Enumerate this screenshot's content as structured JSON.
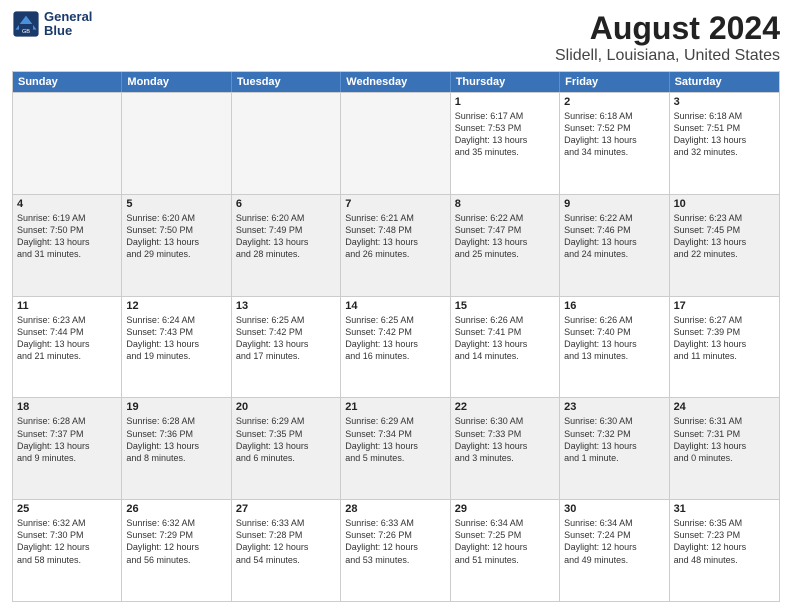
{
  "header": {
    "logo_line1": "General",
    "logo_line2": "Blue",
    "title": "August 2024",
    "subtitle": "Slidell, Louisiana, United States"
  },
  "weekdays": [
    "Sunday",
    "Monday",
    "Tuesday",
    "Wednesday",
    "Thursday",
    "Friday",
    "Saturday"
  ],
  "weeks": [
    [
      {
        "day": "",
        "info": "",
        "empty": true
      },
      {
        "day": "",
        "info": "",
        "empty": true
      },
      {
        "day": "",
        "info": "",
        "empty": true
      },
      {
        "day": "",
        "info": "",
        "empty": true
      },
      {
        "day": "1",
        "info": "Sunrise: 6:17 AM\nSunset: 7:53 PM\nDaylight: 13 hours\nand 35 minutes."
      },
      {
        "day": "2",
        "info": "Sunrise: 6:18 AM\nSunset: 7:52 PM\nDaylight: 13 hours\nand 34 minutes."
      },
      {
        "day": "3",
        "info": "Sunrise: 6:18 AM\nSunset: 7:51 PM\nDaylight: 13 hours\nand 32 minutes."
      }
    ],
    [
      {
        "day": "4",
        "info": "Sunrise: 6:19 AM\nSunset: 7:50 PM\nDaylight: 13 hours\nand 31 minutes."
      },
      {
        "day": "5",
        "info": "Sunrise: 6:20 AM\nSunset: 7:50 PM\nDaylight: 13 hours\nand 29 minutes."
      },
      {
        "day": "6",
        "info": "Sunrise: 6:20 AM\nSunset: 7:49 PM\nDaylight: 13 hours\nand 28 minutes."
      },
      {
        "day": "7",
        "info": "Sunrise: 6:21 AM\nSunset: 7:48 PM\nDaylight: 13 hours\nand 26 minutes."
      },
      {
        "day": "8",
        "info": "Sunrise: 6:22 AM\nSunset: 7:47 PM\nDaylight: 13 hours\nand 25 minutes."
      },
      {
        "day": "9",
        "info": "Sunrise: 6:22 AM\nSunset: 7:46 PM\nDaylight: 13 hours\nand 24 minutes."
      },
      {
        "day": "10",
        "info": "Sunrise: 6:23 AM\nSunset: 7:45 PM\nDaylight: 13 hours\nand 22 minutes."
      }
    ],
    [
      {
        "day": "11",
        "info": "Sunrise: 6:23 AM\nSunset: 7:44 PM\nDaylight: 13 hours\nand 21 minutes."
      },
      {
        "day": "12",
        "info": "Sunrise: 6:24 AM\nSunset: 7:43 PM\nDaylight: 13 hours\nand 19 minutes."
      },
      {
        "day": "13",
        "info": "Sunrise: 6:25 AM\nSunset: 7:42 PM\nDaylight: 13 hours\nand 17 minutes."
      },
      {
        "day": "14",
        "info": "Sunrise: 6:25 AM\nSunset: 7:42 PM\nDaylight: 13 hours\nand 16 minutes."
      },
      {
        "day": "15",
        "info": "Sunrise: 6:26 AM\nSunset: 7:41 PM\nDaylight: 13 hours\nand 14 minutes."
      },
      {
        "day": "16",
        "info": "Sunrise: 6:26 AM\nSunset: 7:40 PM\nDaylight: 13 hours\nand 13 minutes."
      },
      {
        "day": "17",
        "info": "Sunrise: 6:27 AM\nSunset: 7:39 PM\nDaylight: 13 hours\nand 11 minutes."
      }
    ],
    [
      {
        "day": "18",
        "info": "Sunrise: 6:28 AM\nSunset: 7:37 PM\nDaylight: 13 hours\nand 9 minutes."
      },
      {
        "day": "19",
        "info": "Sunrise: 6:28 AM\nSunset: 7:36 PM\nDaylight: 13 hours\nand 8 minutes."
      },
      {
        "day": "20",
        "info": "Sunrise: 6:29 AM\nSunset: 7:35 PM\nDaylight: 13 hours\nand 6 minutes."
      },
      {
        "day": "21",
        "info": "Sunrise: 6:29 AM\nSunset: 7:34 PM\nDaylight: 13 hours\nand 5 minutes."
      },
      {
        "day": "22",
        "info": "Sunrise: 6:30 AM\nSunset: 7:33 PM\nDaylight: 13 hours\nand 3 minutes."
      },
      {
        "day": "23",
        "info": "Sunrise: 6:30 AM\nSunset: 7:32 PM\nDaylight: 13 hours\nand 1 minute."
      },
      {
        "day": "24",
        "info": "Sunrise: 6:31 AM\nSunset: 7:31 PM\nDaylight: 13 hours\nand 0 minutes."
      }
    ],
    [
      {
        "day": "25",
        "info": "Sunrise: 6:32 AM\nSunset: 7:30 PM\nDaylight: 12 hours\nand 58 minutes."
      },
      {
        "day": "26",
        "info": "Sunrise: 6:32 AM\nSunset: 7:29 PM\nDaylight: 12 hours\nand 56 minutes."
      },
      {
        "day": "27",
        "info": "Sunrise: 6:33 AM\nSunset: 7:28 PM\nDaylight: 12 hours\nand 54 minutes."
      },
      {
        "day": "28",
        "info": "Sunrise: 6:33 AM\nSunset: 7:26 PM\nDaylight: 12 hours\nand 53 minutes."
      },
      {
        "day": "29",
        "info": "Sunrise: 6:34 AM\nSunset: 7:25 PM\nDaylight: 12 hours\nand 51 minutes."
      },
      {
        "day": "30",
        "info": "Sunrise: 6:34 AM\nSunset: 7:24 PM\nDaylight: 12 hours\nand 49 minutes."
      },
      {
        "day": "31",
        "info": "Sunrise: 6:35 AM\nSunset: 7:23 PM\nDaylight: 12 hours\nand 48 minutes."
      }
    ]
  ]
}
